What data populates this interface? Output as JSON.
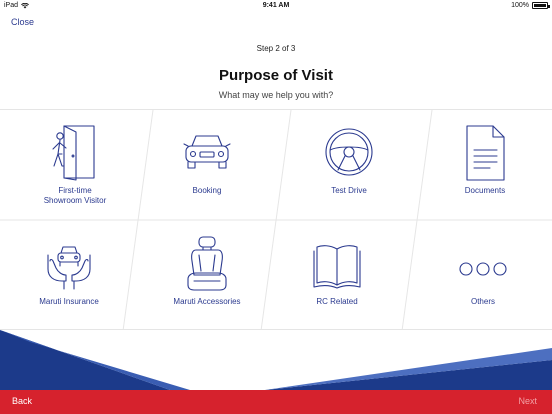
{
  "status": {
    "device": "iPad",
    "time": "9:41 AM",
    "battery": "100%"
  },
  "nav": {
    "close_label": "Close",
    "back_label": "Back",
    "next_label": "Next"
  },
  "header": {
    "step": "Step 2 of 3",
    "title": "Purpose of Visit",
    "subtitle": "What may we help you with?"
  },
  "options": [
    {
      "label": "First-time\nShowroom Visitor",
      "icon": "door-walk-icon"
    },
    {
      "label": "Booking",
      "icon": "car-icon"
    },
    {
      "label": "Test Drive",
      "icon": "steering-wheel-icon"
    },
    {
      "label": "Documents",
      "icon": "document-icon"
    },
    {
      "label": "Maruti Insurance",
      "icon": "car-in-hands-icon"
    },
    {
      "label": "Maruti Accessories",
      "icon": "car-seat-icon"
    },
    {
      "label": "RC Related",
      "icon": "open-book-icon"
    },
    {
      "label": "Others",
      "icon": "more-dots-icon"
    }
  ],
  "colors": {
    "accent": "#2b3a8f",
    "bottom_bar": "#d6222d",
    "navy": "#1c3a8a"
  }
}
